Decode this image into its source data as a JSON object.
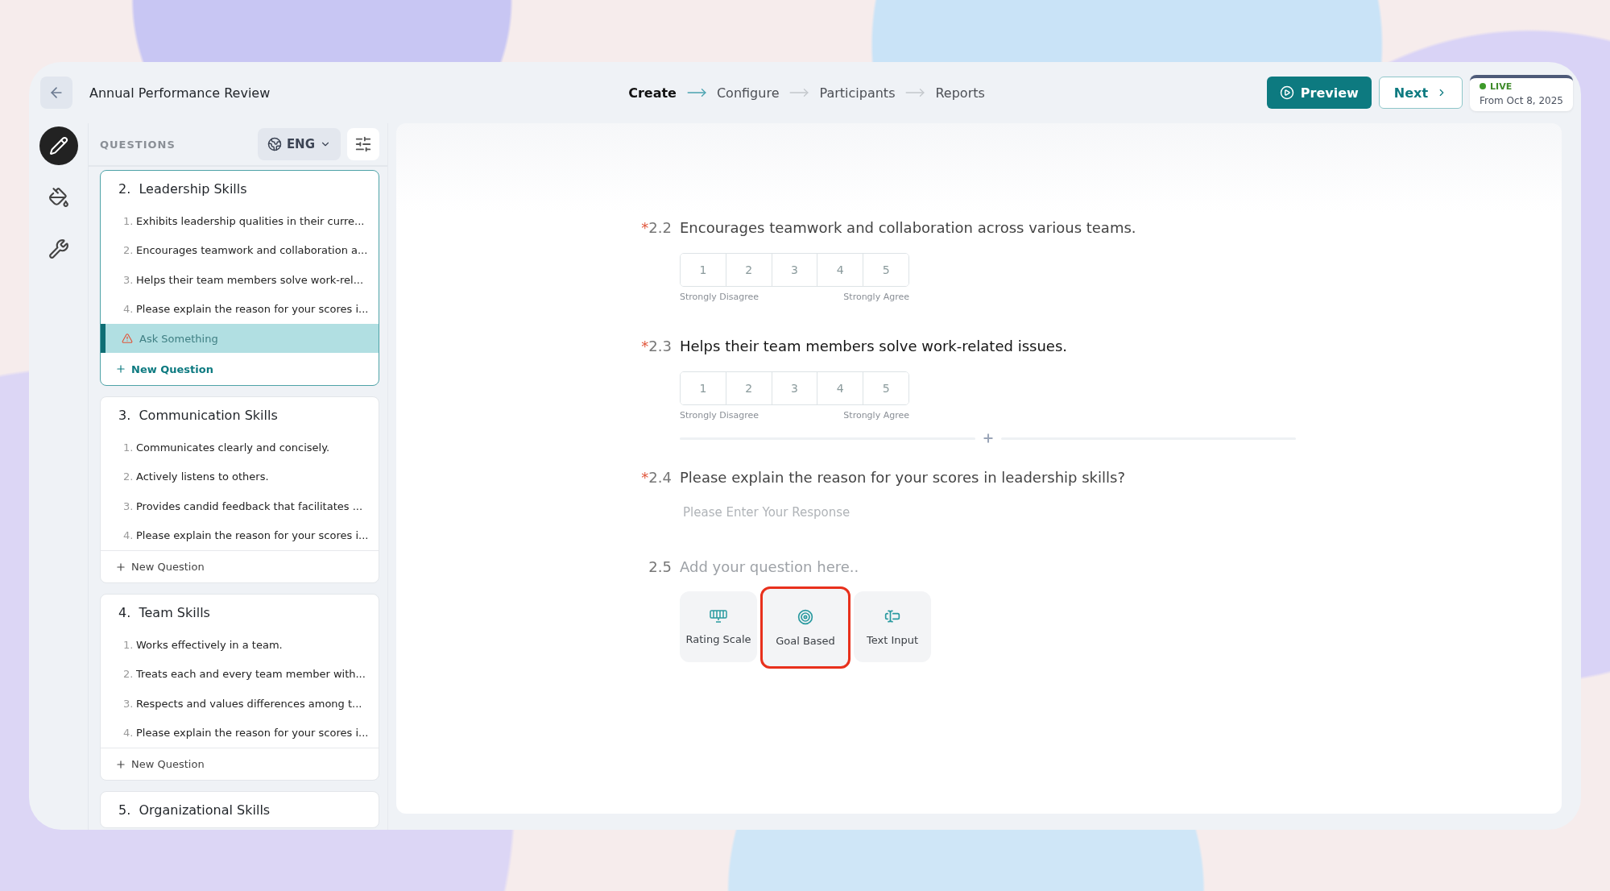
{
  "header": {
    "title": "Annual Performance Review",
    "steps": [
      {
        "label": "Create",
        "selected": true
      },
      {
        "label": "Configure",
        "selected": false
      },
      {
        "label": "Participants",
        "selected": false
      },
      {
        "label": "Reports",
        "selected": false
      }
    ],
    "preview_button": "Preview",
    "next_button": "Next",
    "status": {
      "label": "LIVE",
      "date": "From Oct 8, 2025"
    }
  },
  "rail": [
    {
      "kind": "edit",
      "selected": true
    },
    {
      "kind": "style",
      "selected": false
    },
    {
      "kind": "tools",
      "selected": false
    }
  ],
  "questions_panel": {
    "heading": "QUESTIONS",
    "language": "ENG",
    "sections": [
      {
        "number": "2.",
        "title": "Leadership Skills",
        "selected": true,
        "items": [
          {
            "number": "1.",
            "text": "Exhibits leadership qualities in their curre..."
          },
          {
            "number": "2.",
            "text": "Encourages teamwork and collaboration a..."
          },
          {
            "number": "3.",
            "text": "Helps their team members solve work-rel..."
          },
          {
            "number": "4.",
            "text": "Please explain the reason for your scores i..."
          }
        ],
        "draft": "Ask Something",
        "new_question": "New Question"
      },
      {
        "number": "3.",
        "title": "Communication Skills",
        "selected": false,
        "items": [
          {
            "number": "1.",
            "text": "Communicates clearly and concisely."
          },
          {
            "number": "2.",
            "text": "Actively listens to others."
          },
          {
            "number": "3.",
            "text": "Provides candid feedback that facilitates ..."
          },
          {
            "number": "4.",
            "text": "Please explain the reason for your scores i..."
          }
        ],
        "new_question": "New Question"
      },
      {
        "number": "4.",
        "title": "Team Skills",
        "selected": false,
        "items": [
          {
            "number": "1.",
            "text": "Works effectively in a team."
          },
          {
            "number": "2.",
            "text": "Treats each and every team member with..."
          },
          {
            "number": "3.",
            "text": "Respects and values differences among t..."
          },
          {
            "number": "4.",
            "text": "Please explain the reason for your scores i..."
          }
        ],
        "new_question": "New Question"
      },
      {
        "number": "5.",
        "title": "Organizational Skills",
        "selected": false
      }
    ]
  },
  "editor": {
    "questions": [
      {
        "kind": "rating",
        "number": "2.2",
        "required_mark": "*",
        "active": false,
        "text": "Encourages teamwork and collaboration across various teams.",
        "scale": [
          "1",
          "2",
          "3",
          "4",
          "5"
        ],
        "low_label": "Strongly Disagree",
        "high_label": "Strongly Agree"
      },
      {
        "kind": "rating",
        "number": "2.3",
        "required_mark": "*",
        "active": true,
        "text": "Helps their team members solve work-related issues.",
        "scale": [
          "1",
          "2",
          "3",
          "4",
          "5"
        ],
        "low_label": "Strongly Disagree",
        "high_label": "Strongly Agree"
      },
      {
        "kind": "text",
        "number": "2.4",
        "required_mark": "*",
        "active": false,
        "text": "Please explain the reason for your scores in leadership skills?",
        "placeholder": "Please Enter Your Response"
      }
    ],
    "new_question": {
      "number": "2.5",
      "placeholder": "Add your question here..",
      "types": [
        {
          "kind": "rating_scale",
          "label": "Rating Scale",
          "selected": false
        },
        {
          "kind": "goal",
          "label": "Goal Based",
          "selected": true
        },
        {
          "kind": "text_input",
          "label": "Text Input",
          "selected": false
        }
      ]
    }
  }
}
